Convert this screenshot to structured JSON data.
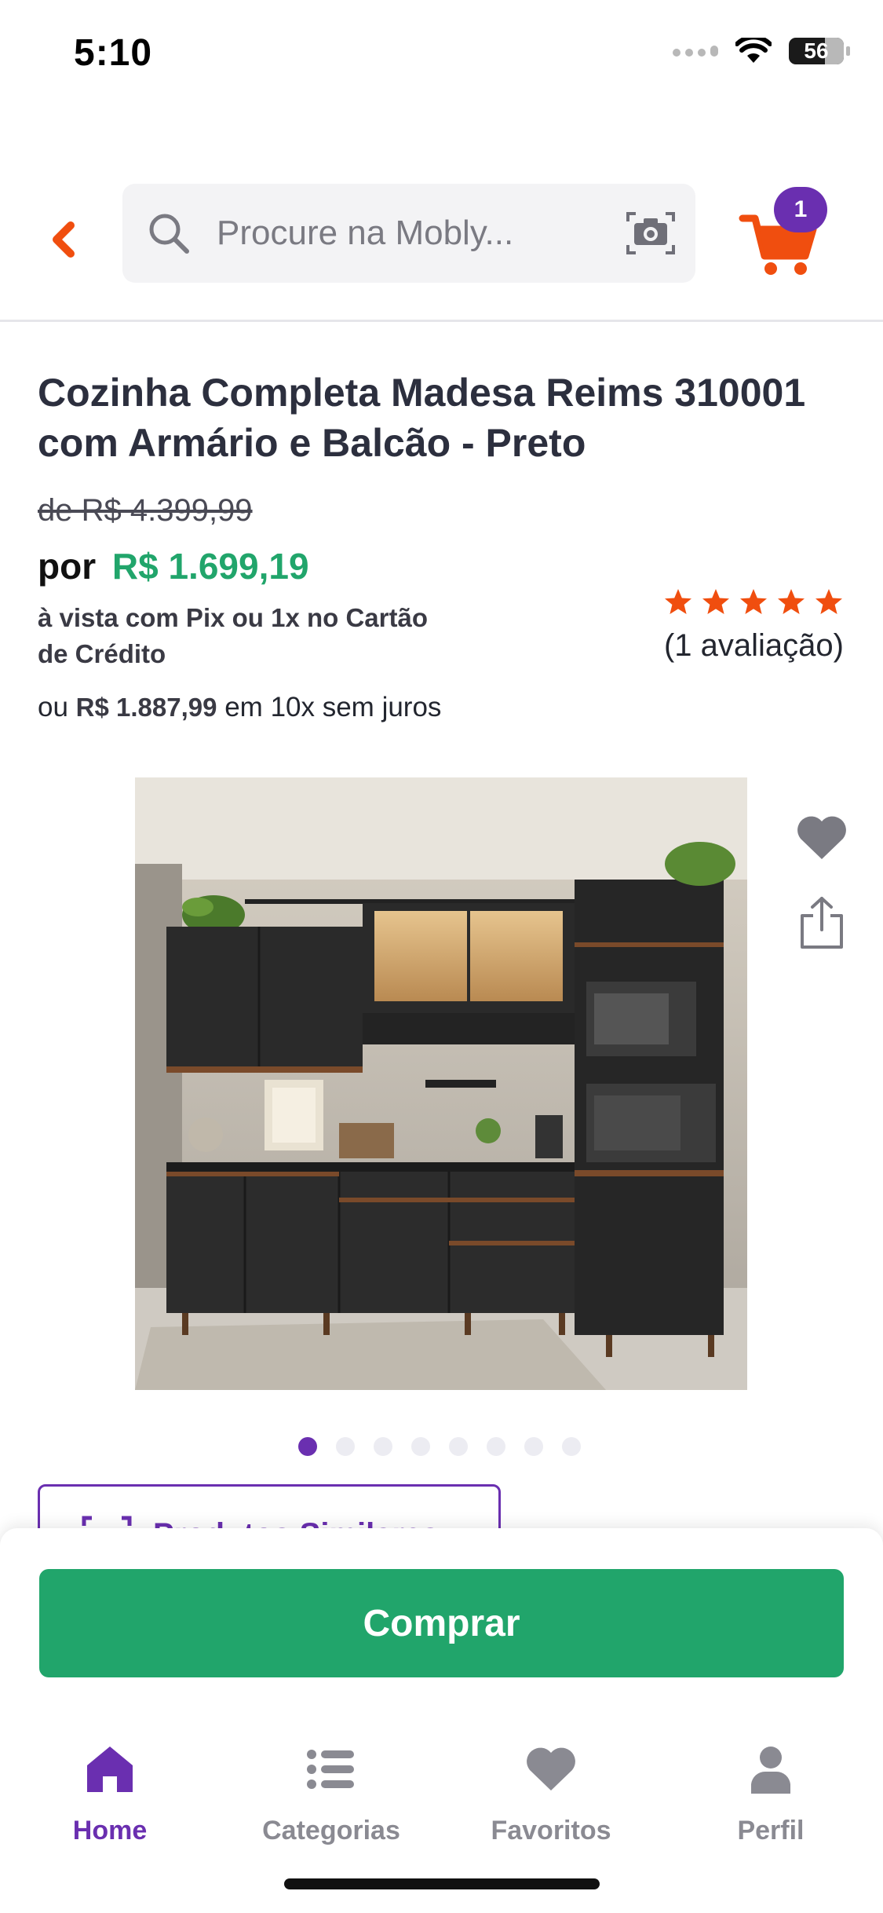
{
  "status_bar": {
    "time": "5:10",
    "battery": "56"
  },
  "header": {
    "search_placeholder": "Procure na Mobly...",
    "cart_count": "1"
  },
  "product": {
    "title": "Cozinha Completa Madesa Reims 310001 com Armário e Balcão - Preto",
    "old_price": "de R$ 4.399,99",
    "price_prefix": "por",
    "price": "R$ 1.699,19",
    "pix_text": "à vista com Pix ou 1x no Cartão de Crédito",
    "installment_prefix": "ou",
    "installment_value": "R$ 1.887,99",
    "installment_suffix": "em 10x sem juros",
    "rating_stars": 5,
    "rating_count": "(1 avaliação)"
  },
  "carousel": {
    "total": 8,
    "active_index": 0
  },
  "similar_button_label": "Produtos Similares",
  "buy_button_label": "Comprar",
  "tab_bar": {
    "home": "Home",
    "categories": "Categorias",
    "favorites": "Favoritos",
    "profile": "Perfil"
  },
  "colors": {
    "brand_purple": "#6a2fb0",
    "price_green": "#21a56b",
    "accent_orange": "#f04e0f",
    "star_orange": "#f04e0f"
  }
}
